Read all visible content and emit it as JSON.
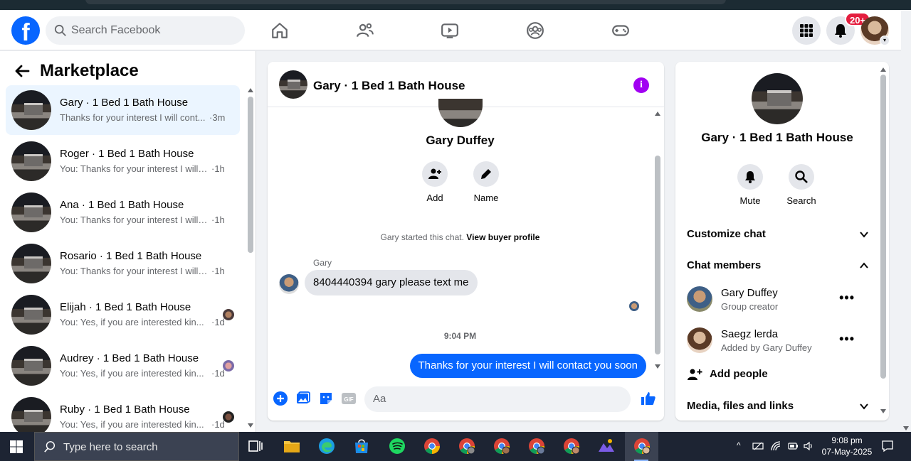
{
  "header": {
    "search_placeholder": "Search Facebook",
    "notification_badge": "20+"
  },
  "left": {
    "title": "Marketplace",
    "conversations": [
      {
        "name": "Gary · 1 Bed 1 Bath House",
        "preview": "Thanks for your interest I will cont...",
        "time": "·3m"
      },
      {
        "name": "Roger · 1 Bed 1 Bath House",
        "preview": "You: Thanks for your interest I will c...",
        "time": "·1h"
      },
      {
        "name": "Ana · 1 Bed 1 Bath House",
        "preview": "You: Thanks for your interest I will c...",
        "time": "·1h"
      },
      {
        "name": "Rosario · 1 Bed 1 Bath House",
        "preview": "You: Thanks for your interest I will c...",
        "time": "·1h"
      },
      {
        "name": "Elijah · 1 Bed 1 Bath House",
        "preview": "You: Yes, if you are interested kin...",
        "time": "·1d"
      },
      {
        "name": "Audrey · 1 Bed 1 Bath House",
        "preview": "You: Yes, if you are interested kin...",
        "time": "·1d"
      },
      {
        "name": "Ruby · 1 Bed 1 Bath House",
        "preview": "You: Yes, if you are interested kin...",
        "time": "·1d"
      }
    ]
  },
  "chat": {
    "title": "Gary · 1 Bed 1 Bath House",
    "contact_name": "Gary Duffey",
    "actions": {
      "add": "Add",
      "name": "Name"
    },
    "started_text": "Gary started this chat.",
    "view_profile": "View buyer profile",
    "sender": "Gary",
    "incoming_message": "8404440394 gary please text me",
    "timestamp": "9:04 PM",
    "outgoing_message": "Thanks for your interest I will contact you soon",
    "composer_placeholder": "Aa"
  },
  "right": {
    "title": "Gary · 1 Bed 1 Bath House",
    "actions": {
      "mute": "Mute",
      "search": "Search"
    },
    "customize": "Customize chat",
    "members_heading": "Chat members",
    "members": [
      {
        "name": "Gary Duffey",
        "role": "Group creator"
      },
      {
        "name": "Saegz lerda",
        "role": "Added by Gary Duffey"
      }
    ],
    "add_people": "Add people",
    "media": "Media, files and links"
  },
  "taskbar": {
    "search_placeholder": "Type here to search",
    "time": "9:08 pm",
    "date": "07-May-2025"
  }
}
